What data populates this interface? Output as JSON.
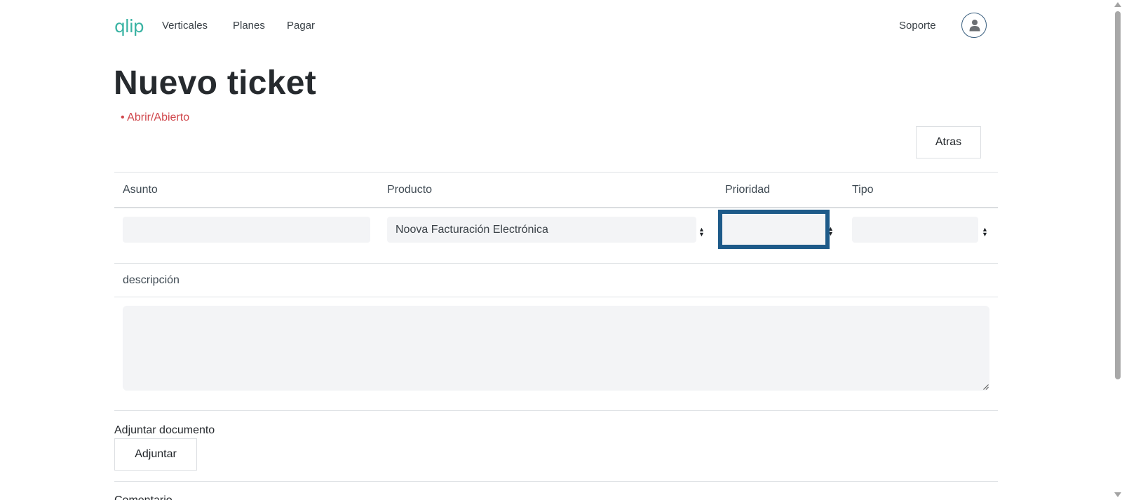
{
  "nav": {
    "logo": "qlip",
    "links": [
      "Verticales",
      "Planes",
      "Pagar"
    ],
    "support": "Soporte",
    "avatar_icon": "user-icon"
  },
  "page": {
    "title": "Nuevo ticket",
    "status": "• Abrir/Abierto",
    "status_color": "#d0474c",
    "back_button": "Atras"
  },
  "form": {
    "columns": [
      "Asunto",
      "Producto",
      "Prioridad",
      "Tipo"
    ],
    "asunto_value": "",
    "producto_value": "Noova Facturación Electrónica",
    "prioridad_value": "",
    "tipo_value": "",
    "description_label": "descripción",
    "description_value": "",
    "attach_label": "Adjuntar documento",
    "attach_button": "Adjuntar",
    "comment_label": "Comentario"
  },
  "colors": {
    "accent": "#3ab3a3",
    "focus": "#1d5a89",
    "field_bg": "#f3f4f6"
  }
}
